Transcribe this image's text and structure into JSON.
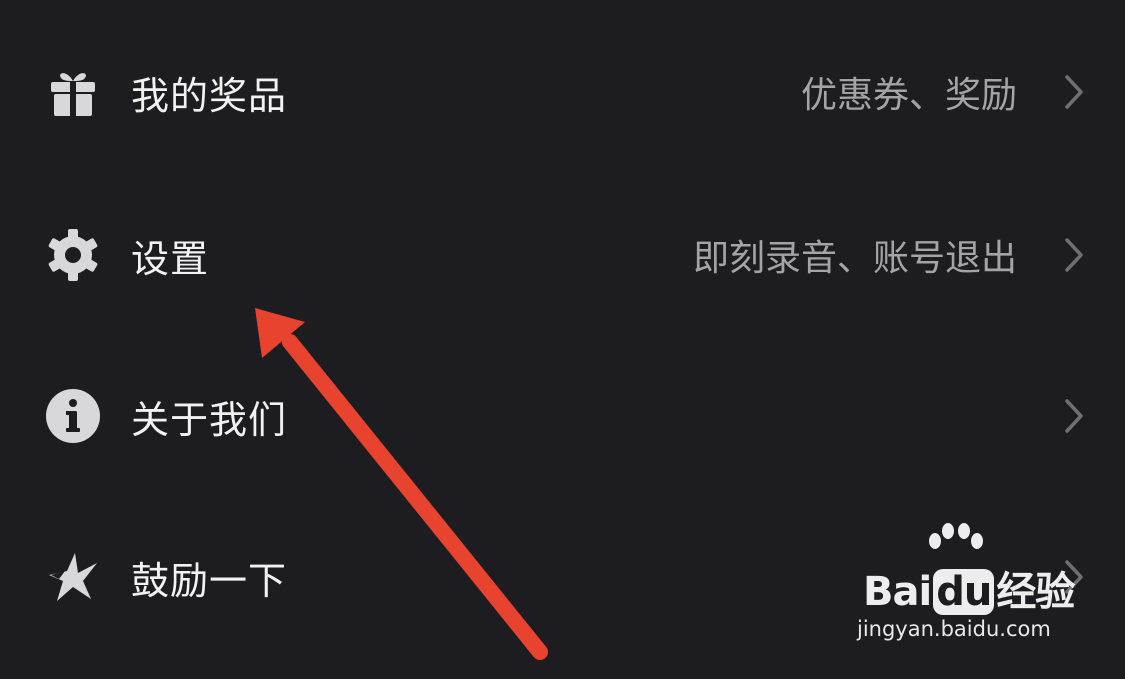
{
  "menu": {
    "items": [
      {
        "label": "我的奖品",
        "subtitle": "优惠券、奖励",
        "icon": "gift-icon"
      },
      {
        "label": "设置",
        "subtitle": "即刻录音、账号退出",
        "icon": "gear-icon"
      },
      {
        "label": "关于我们",
        "subtitle": "",
        "icon": "info-icon"
      },
      {
        "label": "鼓励一下",
        "subtitle": "",
        "icon": "star-icon"
      }
    ]
  },
  "annotation": {
    "color": "#e8432f"
  },
  "watermark": {
    "brand_left": "Bai",
    "brand_mid": "du",
    "brand_right": "经验",
    "url": "jingyan.baidu.com"
  },
  "colors": {
    "background": "#1d1d21",
    "label": "#f2f2f2",
    "subtitle": "#a4a4a8",
    "icon": "#d8d8da",
    "chevron": "#6e6e74"
  }
}
